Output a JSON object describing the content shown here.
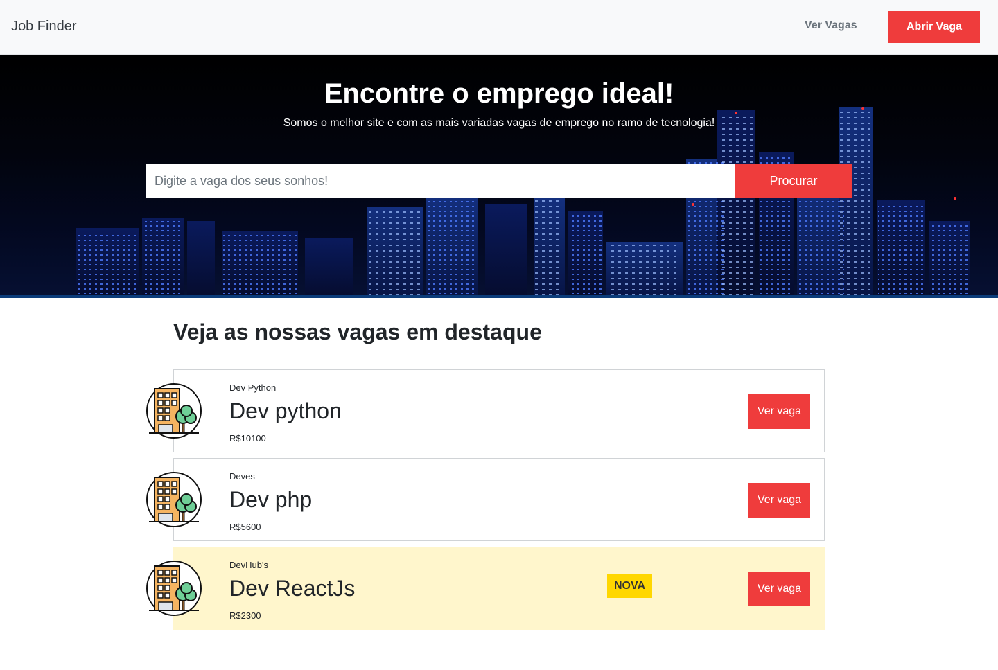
{
  "navbar": {
    "brand": "Job Finder",
    "link_label": "Ver Vagas",
    "cta_label": "Abrir Vaga"
  },
  "hero": {
    "title": "Encontre o emprego ideal!",
    "subtitle": "Somos o melhor site e com as mais variadas vagas de emprego no ramo de tecnologia!",
    "search_placeholder": "Digite a vaga dos seus sonhos!",
    "search_button_label": "Procurar"
  },
  "jobs_section": {
    "title": "Veja as nossas vagas em destaque",
    "jobs": [
      {
        "company": "Dev Python",
        "title": "Dev python",
        "salary": "R$10100",
        "button_label": "Ver vaga",
        "badge": ""
      },
      {
        "company": "Deves",
        "title": "Dev php",
        "salary": "R$5600",
        "button_label": "Ver vaga",
        "badge": ""
      },
      {
        "company": "DevHub's",
        "title": "Dev ReactJs",
        "salary": "R$2300",
        "button_label": "Ver vaga",
        "badge": "NOVA"
      }
    ]
  },
  "colors": {
    "accent": "#ef3c3c",
    "navbar_bg": "#f8f9fa",
    "highlight_bg": "#fff6cc",
    "badge_bg": "#ffd700"
  },
  "icons": {
    "job_logo": "building-tree-icon"
  }
}
